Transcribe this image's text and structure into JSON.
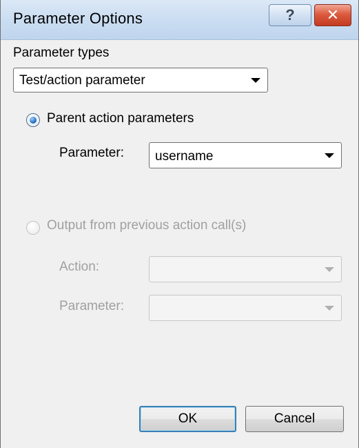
{
  "window": {
    "title": "Parameter Options",
    "help_glyph": "?",
    "close_glyph": "✕"
  },
  "parameter_types": {
    "label": "Parameter types",
    "selected": "Test/action parameter"
  },
  "parent_action": {
    "radio_label": "Parent action parameters",
    "selected": true,
    "parameter_label": "Parameter:",
    "parameter_value": "username"
  },
  "output_previous": {
    "radio_label": "Output from previous action call(s)",
    "selected": false,
    "enabled": false,
    "action_label": "Action:",
    "action_value": "",
    "parameter_label": "Parameter:",
    "parameter_value": ""
  },
  "buttons": {
    "ok": "OK",
    "cancel": "Cancel"
  },
  "icons": {
    "help": "help-icon",
    "close": "close-icon",
    "dropdown": "chevron-down-icon"
  },
  "colors": {
    "titlebar": "#c9dcf1",
    "close_button": "#c23b21",
    "radio_selected": "#2a72c4",
    "default_button_border": "#3c7fb1"
  }
}
